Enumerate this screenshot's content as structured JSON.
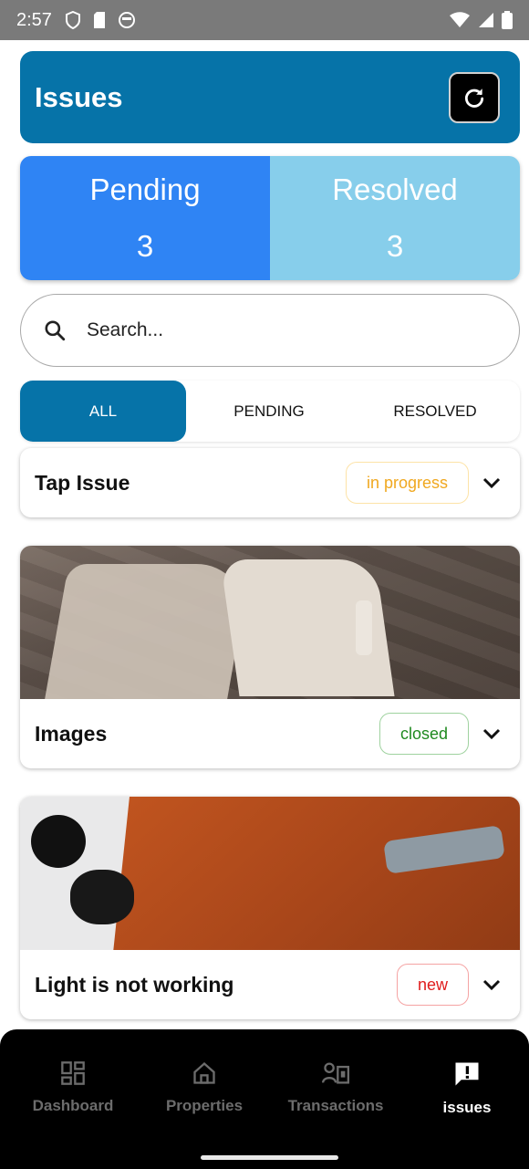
{
  "status_bar": {
    "time": "2:57"
  },
  "header": {
    "title": "Issues"
  },
  "stats": {
    "pending": {
      "label": "Pending",
      "count": "3"
    },
    "resolved": {
      "label": "Resolved",
      "count": "3"
    }
  },
  "search": {
    "placeholder": "Search..."
  },
  "filter_tabs": [
    {
      "label": "ALL",
      "active": true
    },
    {
      "label": "PENDING",
      "active": false
    },
    {
      "label": "RESOLVED",
      "active": false
    }
  ],
  "issues": [
    {
      "title": "Tap Issue",
      "status": "in progress",
      "status_color": "#f0a820",
      "status_border": "#fde3a7",
      "has_image": false
    },
    {
      "title": "Images",
      "status": "closed",
      "status_color": "#1f8a1f",
      "status_border": "#9fd29f",
      "has_image": true,
      "image": "toy-figure-photo"
    },
    {
      "title": "Light is not working",
      "status": "new",
      "status_color": "#e01c1c",
      "status_border": "#f5a3a3",
      "has_image": true,
      "image": "earbuds-notebook-photo"
    }
  ],
  "bottom_nav": [
    {
      "label": "Dashboard",
      "icon": "dashboard-icon",
      "active": false
    },
    {
      "label": "Properties",
      "icon": "home-icon",
      "active": false
    },
    {
      "label": "Transactions",
      "icon": "transactions-icon",
      "active": false
    },
    {
      "label": "issues",
      "icon": "issue-alert-icon",
      "active": true
    }
  ],
  "colors": {
    "primary": "#0673a8",
    "pending": "#2f84f4",
    "resolved": "#87ceeb"
  }
}
